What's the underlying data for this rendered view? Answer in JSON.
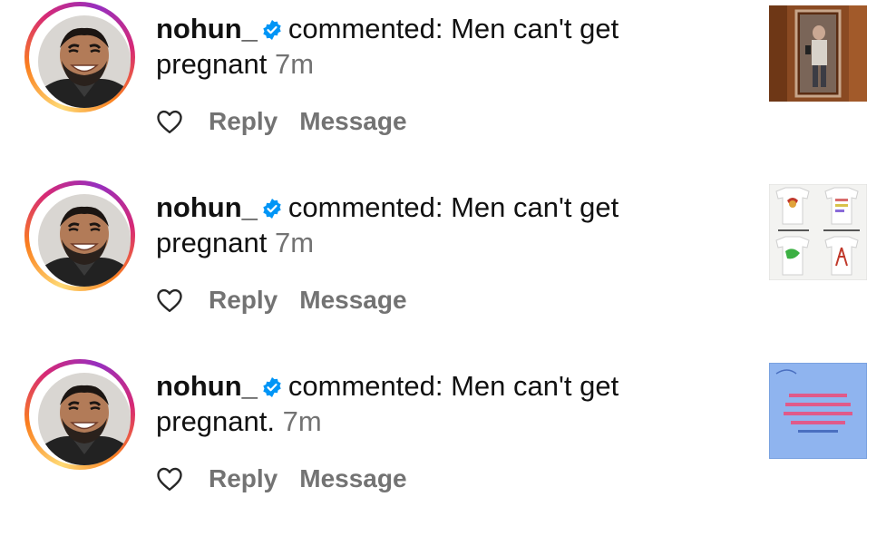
{
  "notifications": [
    {
      "username": "nohun_",
      "message": "commented: Men can't get",
      "message_cont": "pregnant",
      "time": "7m",
      "actions": {
        "reply": "Reply",
        "message": "Message"
      },
      "thumbnail": "mirror-selfie-photo"
    },
    {
      "username": "nohun_",
      "message": "commented: Men can't get",
      "message_cont": "pregnant",
      "time": "7m",
      "actions": {
        "reply": "Reply",
        "message": "Message"
      },
      "thumbnail": "tshirt-collage-photo"
    },
    {
      "username": "nohun_",
      "message": "commented: Men can't get",
      "message_cont": "pregnant.",
      "time": "7m",
      "actions": {
        "reply": "Reply",
        "message": "Message"
      },
      "thumbnail": "blue-text-graphic"
    }
  ],
  "colors": {
    "verified_badge": "#0095f6",
    "secondary_text": "#737373",
    "primary_text": "#111111"
  }
}
